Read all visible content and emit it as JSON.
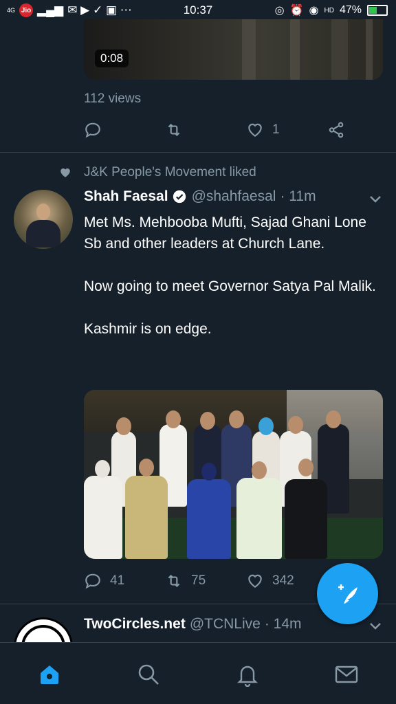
{
  "status_bar": {
    "carrier": "Jio",
    "network": "4G",
    "time": "10:37",
    "hd_label": "HD",
    "battery_percent": "47%",
    "battery_level": 0.47,
    "battery_color": "#33c24d"
  },
  "tweet1": {
    "video_duration": "0:08",
    "views": "112 views",
    "like_count": "1"
  },
  "tweet2": {
    "social_context": "J&K People's Movement liked",
    "name": "Shah Faesal",
    "handle": "@shahfaesal",
    "time": "· 11m",
    "text": "Met Ms. Mehbooba Mufti, Sajad Ghani Lone Sb and other leaders at Church Lane.\n\nNow going to meet Governor Satya Pal Malik.\n\nKashmir is on edge.",
    "reply_count": "41",
    "retweet_count": "75",
    "like_count": "342"
  },
  "tweet3": {
    "name": "TwoCircles.net",
    "handle": "@TCNLive",
    "time": "· 14m"
  },
  "colors": {
    "background": "#15202b",
    "secondary_text": "#8899a6",
    "accent": "#1da1f2",
    "divider": "#38444d"
  },
  "icons": {
    "reply": "reply-icon",
    "retweet": "retweet-icon",
    "like": "heart-icon",
    "share": "share-icon",
    "compose": "compose-tweet-icon",
    "home": "home-icon",
    "search": "search-icon",
    "notifications": "bell-icon",
    "messages": "mail-icon"
  }
}
